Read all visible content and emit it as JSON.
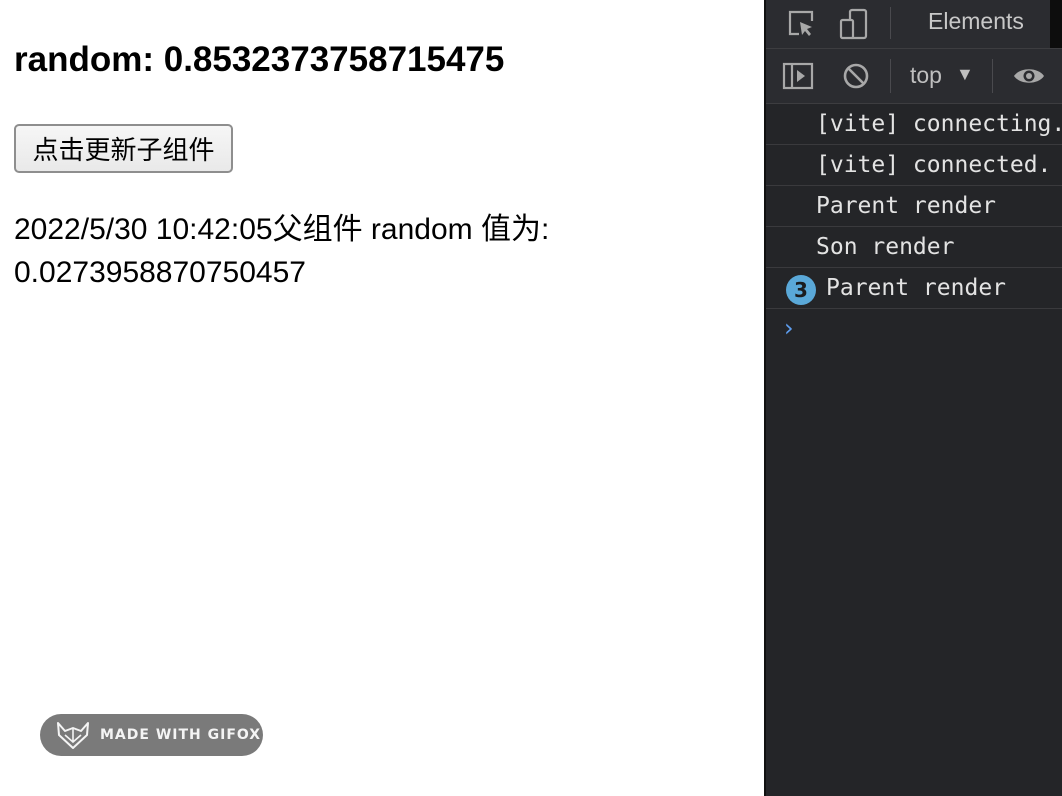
{
  "page": {
    "heading": "random: 0.8532373758715475",
    "button_label": "点击更新子组件",
    "son_text": "2022/5/30 10:42:05父组件 random 值为: 0.0273958870750457",
    "watermark": "MADE WITH GIFOX"
  },
  "devtools": {
    "tab_label": "Elements",
    "context": "top",
    "console_messages": [
      {
        "text": "[vite] connecting...",
        "count": ""
      },
      {
        "text": "[vite] connected.",
        "count": ""
      },
      {
        "text": "Parent render",
        "count": ""
      },
      {
        "text": "Son render",
        "count": ""
      },
      {
        "text": "Parent render",
        "count": "3"
      }
    ],
    "prompt": "›"
  },
  "colors": {
    "devtools_bg": "#242528",
    "badge": "#5aa8d8",
    "prompt": "#5e9ef0"
  },
  "icons": [
    "inspect-icon",
    "device-toggle-icon",
    "sidebar-toggle-icon",
    "clear-console-icon",
    "eye-icon",
    "gifox-logo-icon"
  ]
}
